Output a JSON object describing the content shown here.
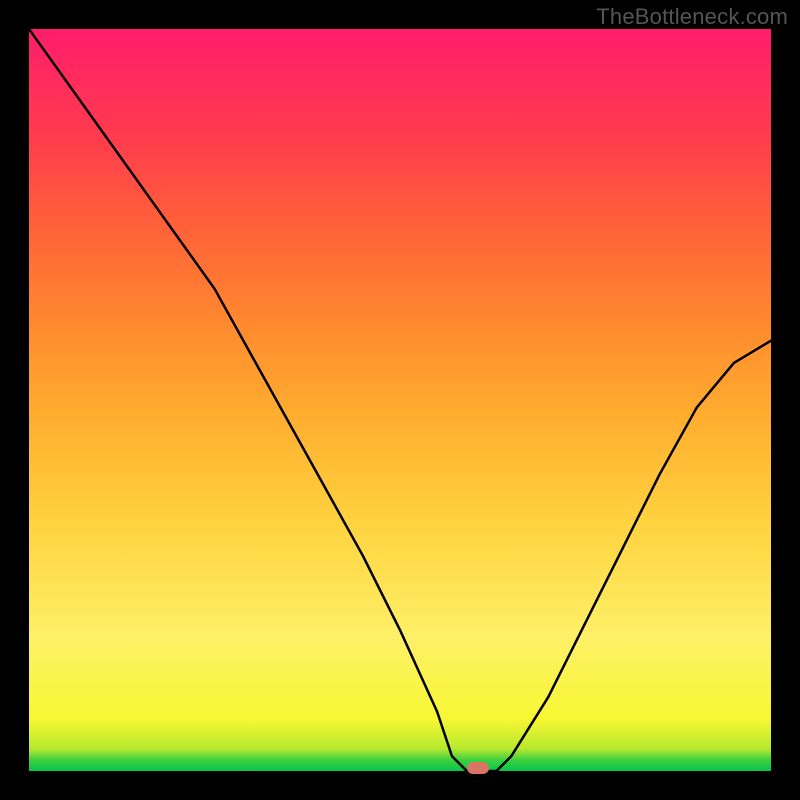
{
  "watermark": "TheBottleneck.com",
  "chart_data": {
    "type": "line",
    "title": "",
    "xlabel": "",
    "ylabel": "",
    "xlim": [
      0,
      100
    ],
    "ylim": [
      0,
      100
    ],
    "series": [
      {
        "name": "bottleneck-curve",
        "x": [
          0,
          5,
          10,
          15,
          20,
          25,
          30,
          35,
          40,
          45,
          50,
          55,
          57,
          59,
          61,
          63,
          65,
          70,
          75,
          80,
          85,
          90,
          95,
          100
        ],
        "y": [
          100,
          93,
          86,
          79,
          72,
          65,
          56,
          47,
          38,
          29,
          19,
          8,
          2,
          0,
          0,
          0,
          2,
          10,
          20,
          30,
          40,
          49,
          55,
          58
        ]
      }
    ],
    "marker": {
      "x": 60.5,
      "y": 0
    },
    "gradient_colors": {
      "top": "#ff1d6b",
      "upper": "#ff5f39",
      "mid": "#ffd13e",
      "lower": "#f7f733",
      "bottom": "#07c44d"
    }
  },
  "layout": {
    "image_size": 800,
    "plot_inset": 29
  }
}
